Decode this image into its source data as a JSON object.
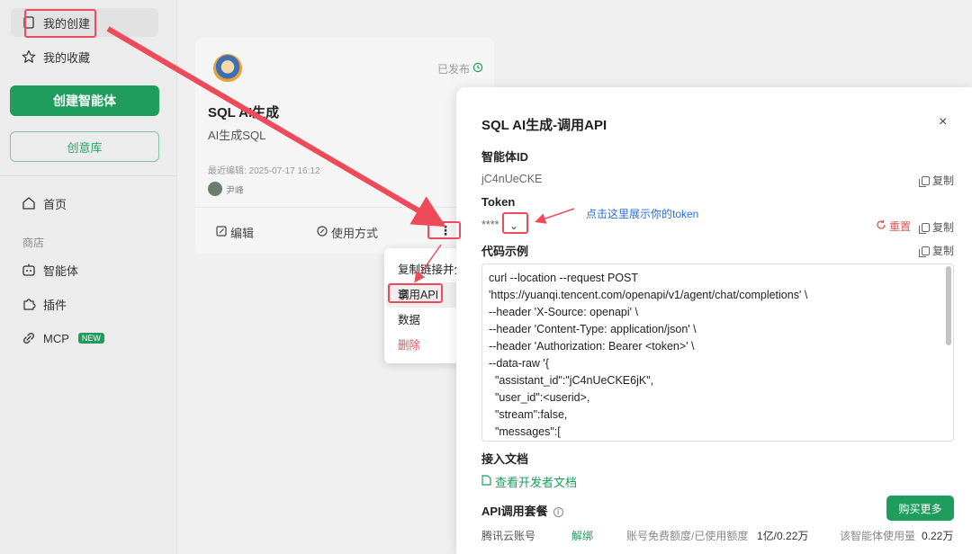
{
  "sidebar": {
    "my_creation": "我的创建",
    "my_favorites": "我的收藏",
    "create_button": "创建智能体",
    "library_button": "创意库",
    "home": "首页",
    "store_label": "商店",
    "agents": "智能体",
    "plugins": "插件",
    "mcp": "MCP",
    "mcp_badge": "NEW"
  },
  "card": {
    "title": "SQL AI生成",
    "description": "AI生成SQL",
    "status": "已发布",
    "edit_time": "最近编辑: 2025-07-17 16:12",
    "author": "尹峰",
    "edit_action": "编辑",
    "usage_action": "使用方式",
    "more": "⋮"
  },
  "menu": {
    "items": [
      {
        "label": "复制链接并分享"
      },
      {
        "label": "调用API"
      },
      {
        "label": "数据"
      },
      {
        "label": "删除"
      }
    ]
  },
  "panel": {
    "title": "SQL AI生成-调用API",
    "close": "×",
    "agent_id_label": "智能体ID",
    "agent_id_value": "jC4nUeCKE",
    "copy": "复制",
    "token_label": "Token",
    "token_value": "****",
    "token_toggle": "⌄",
    "reset": "重置",
    "code_label": "代码示例",
    "code_lines": [
      "curl --location --request POST",
      "'https://yuanqi.tencent.com/openapi/v1/agent/chat/completions' \\",
      "--header 'X-Source: openapi' \\",
      "--header 'Content-Type: application/json' \\",
      "--header 'Authorization: Bearer <token>' \\",
      "--data-raw '{",
      "  \"assistant_id\":\"jC4nUeCKE6jK\",",
      "  \"user_id\":<userid>,",
      "  \"stream\":false,",
      "  \"messages\":["
    ],
    "docs_label": "接入文档",
    "docs_link": "查看开发者文档",
    "package_label": "API调用套餐",
    "buy_more": "购买更多",
    "account_label": "腾讯云账号",
    "unbind": "解绑",
    "quota_label": "账号免费额度/已使用额度",
    "quota_value": "1亿/0.22万",
    "agent_usage_label": "该智能体使用量",
    "agent_usage_value": "0.22万"
  },
  "annotation": {
    "hint": "点击这里展示你的token"
  },
  "colors": {
    "primary_green": "#1f9d5c",
    "annotation_red": "#ee4a5a",
    "link_blue": "#2a6fd6",
    "danger_red": "#e25050"
  }
}
